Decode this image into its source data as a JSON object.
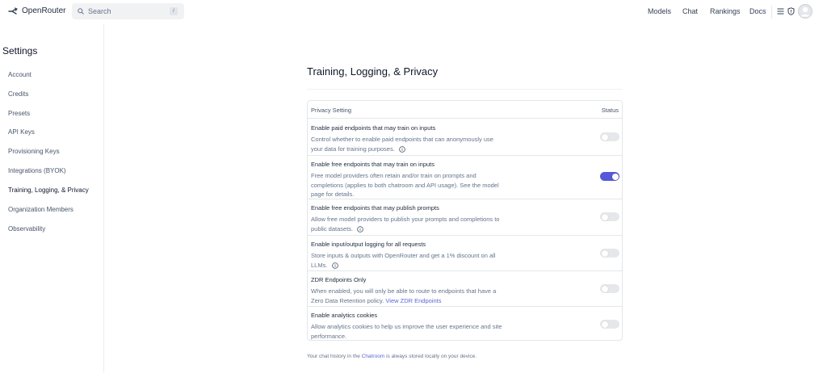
{
  "header": {
    "brand": "OpenRouter",
    "search_placeholder": "Search",
    "search_shortcut": "/",
    "nav": [
      "Models",
      "Chat",
      "Rankings",
      "Docs"
    ],
    "icons": [
      "menu-icon",
      "shield-icon",
      "avatar-icon"
    ]
  },
  "sidebar": {
    "title": "Settings",
    "active_index": 6,
    "items": [
      {
        "label": "Account"
      },
      {
        "label": "Credits"
      },
      {
        "label": "Presets"
      },
      {
        "label": "API Keys"
      },
      {
        "label": "Provisioning Keys"
      },
      {
        "label": "Integrations (BYOK)"
      },
      {
        "label": "Training, Logging, & Privacy"
      },
      {
        "label": "Organization Members"
      },
      {
        "label": "Observability"
      }
    ]
  },
  "main": {
    "title": "Training, Logging, & Privacy",
    "table": {
      "col_setting": "Privacy Setting",
      "col_status": "Status",
      "rows": [
        {
          "title": "Enable paid endpoints that may train on inputs",
          "desc_line1": "Control whether to enable paid endpoints that can anonymously use",
          "desc_line2": "your data for training purposes.",
          "enabled": false
        },
        {
          "title": "Enable free endpoints that may train on inputs",
          "desc_line1": "Free model providers often retain and/or train on prompts and",
          "desc_line2": "completions (applies to both chatroom and API usage). See the model",
          "desc_line3": "page for details.",
          "enabled": true
        },
        {
          "title": "Enable free endpoints that may publish prompts",
          "desc_line1": "Allow free model providers to publish your prompts and completions to",
          "desc_line2": "public datasets.",
          "enabled": false
        },
        {
          "title": "Enable input/output logging for all requests",
          "desc_line1": "Store inputs & outputs with OpenRouter and get a 1% discount on all",
          "desc_line2": "LLMs.",
          "enabled": false
        },
        {
          "title": "ZDR Endpoints Only",
          "desc_line1": "When enabled, you will only be able to route to endpoints that have a",
          "desc_line2": "Zero Data Retention policy.",
          "link": "View ZDR Endpoints",
          "enabled": false
        },
        {
          "title": "Enable analytics cookies",
          "desc_line1": "Allow analytics cookies to help us improve the user experience and site",
          "desc_line2": "performance.",
          "enabled": false
        }
      ]
    },
    "footer": {
      "prefix": "Your chat history in the",
      "link": "Chatroom",
      "suffix": "is always stored locally on your device."
    }
  },
  "colors": {
    "accent": "#5558d9",
    "link": "#5a67d8",
    "toggle_off": "#e5e7eb"
  }
}
